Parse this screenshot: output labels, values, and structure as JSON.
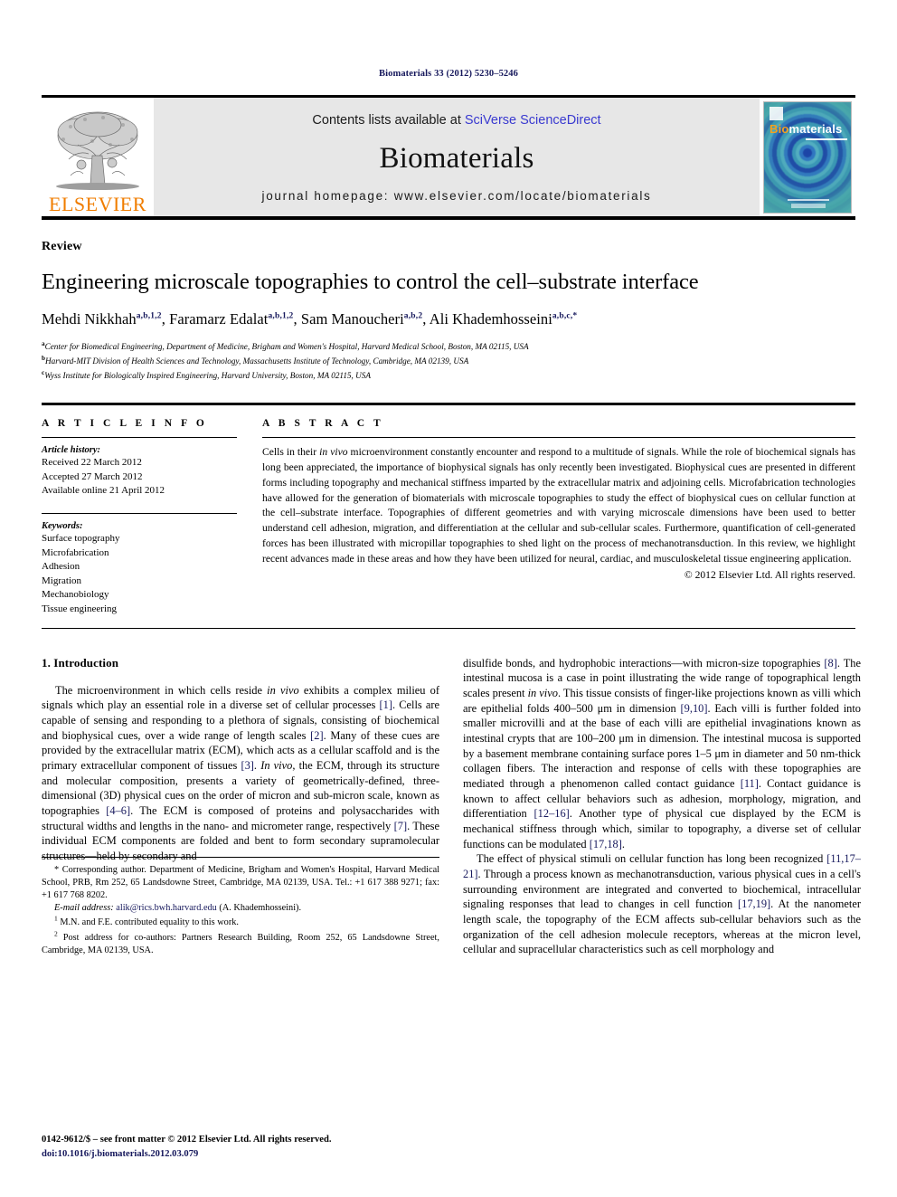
{
  "running_head": "Biomaterials 33 (2012) 5230–5246",
  "masthead": {
    "publisher_name": "ELSEVIER",
    "contents_prefix": "Contents lists available at ",
    "contents_link": "SciVerse ScienceDirect",
    "journal_title": "Biomaterials",
    "homepage": "journal homepage: www.elsevier.com/locate/biomaterials",
    "cover": {
      "title_part1": "Bio",
      "title_part2": "materials",
      "accent_color": "#f3a020",
      "base_color": "#3fa9a6"
    }
  },
  "article": {
    "type": "Review",
    "title": "Engineering microscale topographies to control the cell–substrate interface",
    "authors": [
      {
        "name": "Mehdi Nikkhah",
        "marks": "a,b,1,2",
        "sep": ", "
      },
      {
        "name": "Faramarz Edalat",
        "marks": "a,b,1,2",
        "sep": ", "
      },
      {
        "name": "Sam Manoucheri",
        "marks": "a,b,2",
        "sep": ", "
      },
      {
        "name": "Ali Khademhosseini",
        "marks": "a,b,c,*",
        "sep": ""
      }
    ],
    "affiliations": [
      {
        "mark": "a",
        "text": "Center for Biomedical Engineering, Department of Medicine, Brigham and Women's Hospital, Harvard Medical School, Boston, MA 02115, USA"
      },
      {
        "mark": "b",
        "text": "Harvard-MIT Division of Health Sciences and Technology, Massachusetts Institute of Technology, Cambridge, MA 02139, USA"
      },
      {
        "mark": "c",
        "text": "Wyss Institute for Biologically Inspired Engineering, Harvard University, Boston, MA 02115, USA"
      }
    ]
  },
  "article_info": {
    "heading": "A R T I C L E  I N F O",
    "history_label": "Article history:",
    "history": [
      "Received 22 March 2012",
      "Accepted 27 March 2012",
      "Available online 21 April 2012"
    ],
    "keywords_label": "Keywords:",
    "keywords": [
      "Surface topography",
      "Microfabrication",
      "Adhesion",
      "Migration",
      "Mechanobiology",
      "Tissue engineering"
    ]
  },
  "abstract": {
    "heading": "A B S T R A C T",
    "body_part1": "Cells in their ",
    "body_italic1": "in vivo",
    "body_part2": " microenvironment constantly encounter and respond to a multitude of signals. While the role of biochemical signals has long been appreciated, the importance of biophysical signals has only recently been investigated. Biophysical cues are presented in different forms including topography and mechanical stiffness imparted by the extracellular matrix and adjoining cells. Microfabrication technologies have allowed for the generation of biomaterials with microscale topographies to study the effect of biophysical cues on cellular function at the cell–substrate interface. Topographies of different geometries and with varying microscale dimensions have been used to better understand cell adhesion, migration, and differentiation at the cellular and sub-cellular scales. Furthermore, quantification of cell-generated forces has been illustrated with micropillar topographies to shed light on the process of mechanotransduction. In this review, we highlight recent advances made in these areas and how they have been utilized for neural, cardiac, and musculoskeletal tissue engineering application.",
    "copyright": "© 2012 Elsevier Ltd. All rights reserved."
  },
  "body": {
    "section_number_title": "1.  Introduction",
    "left_paragraphs": [
      "The microenvironment in which cells reside <em>in vivo</em> exhibits a complex milieu of signals which play an essential role in a diverse set of cellular processes <span class=\"ref\">[1]</span>. Cells are capable of sensing and responding to a plethora of signals, consisting of biochemical and biophysical cues, over a wide range of length scales <span class=\"ref\">[2]</span>. Many of these cues are provided by the extracellular matrix (ECM), which acts as a cellular scaffold and is the primary extracellular component of tissues <span class=\"ref\">[3]</span>. <em>In vivo</em>, the ECM, through its structure and molecular composition, presents a variety of geometrically-defined, three-dimensional (3D) physical cues on the order of micron and sub-micron scale, known as topographies <span class=\"ref\">[4–6]</span>. The ECM is composed of proteins and polysaccharides with structural widths and lengths in the nano- and micrometer range, respectively <span class=\"ref\">[7]</span>. These individual ECM components are folded and bent to form secondary supramolecular structures—held by secondary and"
    ],
    "right_paragraphs": [
      "disulfide bonds, and hydrophobic interactions—with micron-size topographies <span class=\"ref\">[8]</span>. The intestinal mucosa is a case in point illustrating the wide range of topographical length scales present <em>in vivo</em>. This tissue consists of finger-like projections known as villi which are epithelial folds 400–500 μm in dimension <span class=\"ref\">[9,10]</span>. Each villi is further folded into smaller microvilli and at the base of each villi are epithelial invaginations known as intestinal crypts that are 100–200 μm in dimension. The intestinal mucosa is supported by a basement membrane containing surface pores 1–5 μm in diameter and 50 nm-thick collagen fibers. The interaction and response of cells with these topographies are mediated through a phenomenon called contact guidance <span class=\"ref\">[11]</span>. Contact guidance is known to affect cellular behaviors such as adhesion, morphology, migration, and differentiation <span class=\"ref\">[12–16]</span>. Another type of physical cue displayed by the ECM is mechanical stiffness through which, similar to topography, a diverse set of cellular functions can be modulated <span class=\"ref\">[17,18]</span>.",
      "The effect of physical stimuli on cellular function has long been recognized <span class=\"ref\">[11,17–21]</span>. Through a process known as mechanotransduction, various physical cues in a cell's surrounding environment are integrated and converted to biochemical, intracellular signaling responses that lead to changes in cell function <span class=\"ref\">[17,19]</span>. At the nanometer length scale, the topography of the ECM affects sub-cellular behaviors such as the organization of the cell adhesion molecule receptors, whereas at the micron level, cellular and supracellular characteristics such as cell morphology and"
    ]
  },
  "footnotes": {
    "corresponding": "* Corresponding author. Department of Medicine, Brigham and Women's Hospital, Harvard Medical School, PRB, Rm 252, 65 Landsdowne Street, Cambridge, MA 02139, USA. Tel.: +1 617 388 9271; fax: +1 617 768 8202.",
    "email_label": "E-mail address:",
    "email": "alik@rics.bwh.harvard.edu",
    "email_suffix": "(A. Khademhosseini).",
    "note1_mark": "1",
    "note1": "M.N. and F.E. contributed equality to this work.",
    "note2_mark": "2",
    "note2": "Post address for co-authors: Partners Research Building, Room 252, 65 Landsdowne Street, Cambridge, MA 02139, USA."
  },
  "colophon": {
    "issn_line": "0142-9612/$ – see front matter © 2012 Elsevier Ltd. All rights reserved.",
    "doi": "doi:10.1016/j.biomaterials.2012.03.079"
  }
}
